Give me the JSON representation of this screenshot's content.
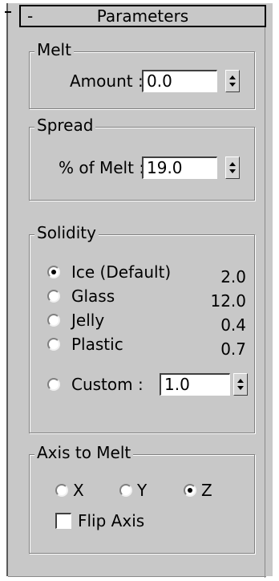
{
  "rollout": {
    "collapse_symbol": "-",
    "title": "Parameters"
  },
  "melt": {
    "title": "Melt",
    "amount_label": "Amount :",
    "amount_value": "0.0"
  },
  "spread": {
    "title": "Spread",
    "label": "% of Melt :",
    "value": "19.0"
  },
  "solidity": {
    "title": "Solidity",
    "options": [
      {
        "label": "Ice (Default)",
        "value": "2.0",
        "selected": true
      },
      {
        "label": "Glass",
        "value": "12.0",
        "selected": false
      },
      {
        "label": "Jelly",
        "value": "0.4",
        "selected": false
      },
      {
        "label": "Plastic",
        "value": "0.7",
        "selected": false
      }
    ],
    "custom_label": "Custom :",
    "custom_value": "1.0",
    "custom_selected": false
  },
  "axis": {
    "title": "Axis to Melt",
    "options": [
      {
        "label": "X",
        "selected": false
      },
      {
        "label": "Y",
        "selected": false
      },
      {
        "label": "Z",
        "selected": true
      }
    ],
    "flip_label": "Flip Axis",
    "flip_checked": false
  },
  "icons": {
    "spinner": "spinner-arrows-icon",
    "radio": "radio-button",
    "check": "checkbox"
  }
}
